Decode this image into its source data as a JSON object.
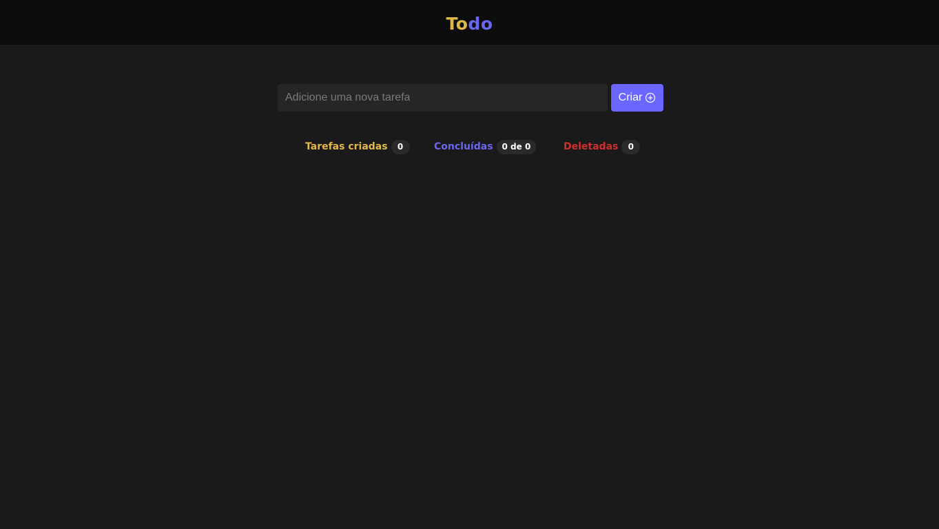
{
  "header": {
    "logo_part1": "To",
    "logo_part2": "do"
  },
  "form": {
    "input_value": "",
    "input_placeholder": "Adicione uma nova tarefa",
    "create_label": "Criar",
    "create_icon": "plus-circle-icon"
  },
  "stats": {
    "created": {
      "label": "Tarefas criadas",
      "count": "0"
    },
    "done": {
      "label": "Concluídas",
      "count": "0 de 0"
    },
    "deleted": {
      "label": "Deletadas",
      "count": "0"
    }
  },
  "colors": {
    "background": "#1a1a1a",
    "header": "#0d0d0d",
    "yellow": "#e0b84a",
    "purple": "#6b66ee",
    "red": "#d0302c",
    "button": "#6b66ff"
  }
}
